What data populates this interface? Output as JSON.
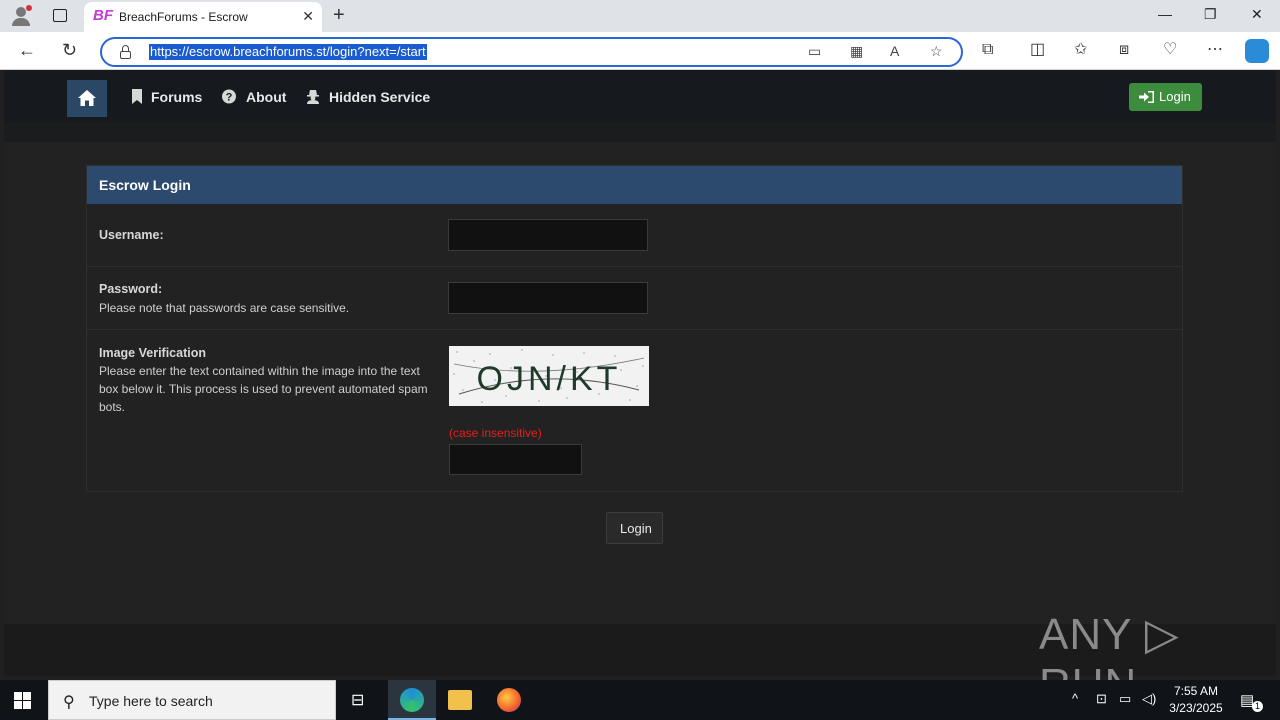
{
  "browser": {
    "tab_title": "BreachForums - Escrow",
    "tab_favicon": "BF",
    "url": "https://escrow.breachforums.st/login?next=/start"
  },
  "site_nav": {
    "items": [
      {
        "label": "Forums",
        "icon": "bookmark-icon"
      },
      {
        "label": "About",
        "icon": "question-circle-icon"
      },
      {
        "label": "Hidden Service",
        "icon": "user-secret-icon"
      }
    ],
    "login_label": "Login"
  },
  "form": {
    "title": "Escrow Login",
    "username_label": "Username:",
    "password_label": "Password:",
    "password_note": "Please note that passwords are case sensitive.",
    "captcha_label": "Image Verification",
    "captcha_note": "Please enter the text contained within the image into the text box below it. This process is used to prevent automated spam bots.",
    "captcha_text": "OJN/KT",
    "case_note": "(case insensitive)",
    "submit_label": "Login"
  },
  "watermark": "ANY ▷ RUN",
  "taskbar": {
    "search_placeholder": "Type here to search",
    "time": "7:55 AM",
    "date": "3/23/2025",
    "notification_count": "1"
  },
  "colors": {
    "panel_header": "#2b4a6d",
    "login_button": "#3d8b3d",
    "case_note": "#e02020",
    "url_highlight": "#1a5ccf"
  }
}
